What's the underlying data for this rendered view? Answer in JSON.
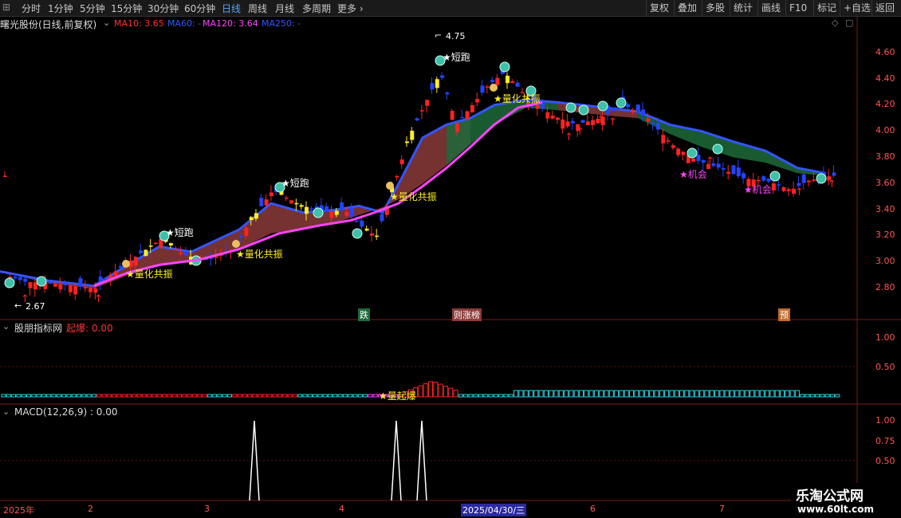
{
  "toolbar": {
    "periods": [
      "分时",
      "1分钟",
      "5分钟",
      "15分钟",
      "30分钟",
      "60分钟",
      "日线",
      "周线",
      "月线",
      "多周期",
      "更多 ›"
    ],
    "active": "日线",
    "right": [
      "复权",
      "叠加",
      "多股",
      "统计",
      "画线",
      "F10",
      "标记",
      "+自选",
      "返回"
    ]
  },
  "main": {
    "stock_title": "曙光股份(日线,前复权)",
    "ma": [
      {
        "label": "MA10: 3.65",
        "color": "#ff3333"
      },
      {
        "label": "MA60: -",
        "color": "#3355ff"
      },
      {
        "label": "MA120: 3.64",
        "color": "#ff44ff"
      },
      {
        "label": "MA250: -",
        "color": "#3355ff"
      }
    ],
    "y_ticks": [
      "4.60",
      "4.40",
      "4.20",
      "4.00",
      "3.80",
      "3.60",
      "3.40",
      "3.20",
      "3.00",
      "2.80"
    ],
    "high_label": "4.75",
    "low_label": "2.67",
    "annotations": [
      "短跑",
      "短跑",
      "短跑",
      "量化共振",
      "量化共振",
      "量化共振",
      "量化共振",
      "机会",
      "机会"
    ],
    "bottom_tags": [
      "跌",
      "则涨榜",
      "预"
    ]
  },
  "panel2": {
    "title": "股朋指标网",
    "indicator": "起爆: 0.00",
    "y_ticks": [
      "1.00",
      "0.50"
    ],
    "annotation": "量起爆"
  },
  "panel3": {
    "title": "MACD(12,26,9) : 0.00",
    "y_ticks": [
      "1.00",
      "0.75",
      "0.50"
    ]
  },
  "dates": [
    "2025年",
    "2",
    "3",
    "4",
    "2025/04/30/三",
    "6",
    "7"
  ],
  "watermark": {
    "title": "乐淘公式网",
    "url": "www.60lt.com"
  },
  "colors": {
    "up": "#ff2222",
    "down": "#2244ff",
    "yellow": "#ffee22",
    "band_red": "#8b3a3a",
    "band_green": "#1d6a3a",
    "ma120": "#ff44ff"
  }
}
